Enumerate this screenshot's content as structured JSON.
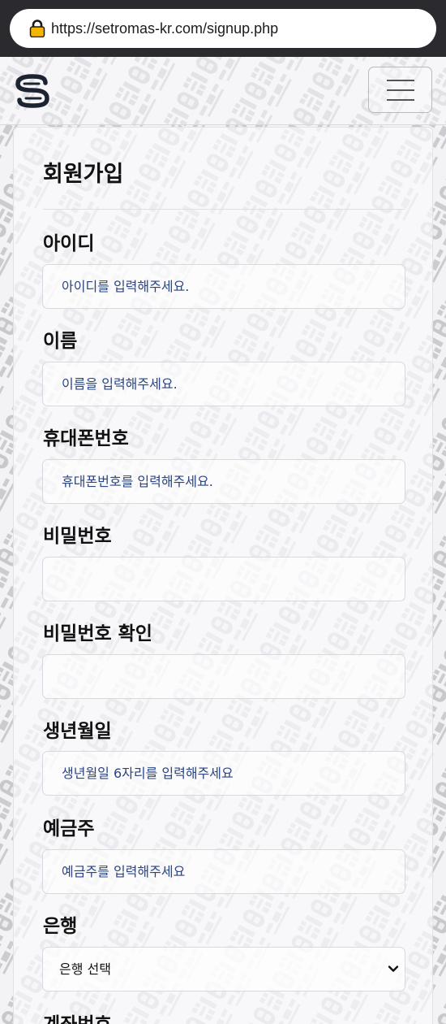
{
  "browser": {
    "url": "https://setromas-kr.com/signup.php"
  },
  "watermark_text": "담덕 법률사무소",
  "form": {
    "title": "회원가입",
    "fields": [
      {
        "label": "아이디",
        "placeholder": "아이디를 입력해주세요."
      },
      {
        "label": "이름",
        "placeholder": "이름을 입력해주세요."
      },
      {
        "label": "휴대폰번호",
        "placeholder": "휴대폰번호를 입력해주세요."
      },
      {
        "label": "비밀번호",
        "placeholder": ""
      },
      {
        "label": "비밀번호 확인",
        "placeholder": ""
      },
      {
        "label": "생년월일",
        "placeholder": "생년월일 6자리를 입력해주세요"
      },
      {
        "label": "예금주",
        "placeholder": "예금주를 입력해주세요"
      }
    ],
    "bank": {
      "label": "은행",
      "selected": "은행 선택"
    },
    "account": {
      "label": "계좌번호"
    }
  }
}
